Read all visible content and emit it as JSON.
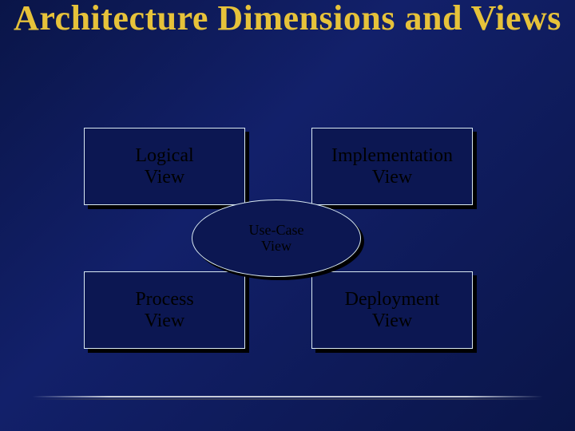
{
  "title_line1": "Architecture Dimensions",
  "title_line2": "and Views",
  "views": {
    "top_left": "Logical View",
    "top_right": "Implementation View",
    "bottom_left": "Process View",
    "bottom_right": "Deployment View",
    "center": "Use-Case View"
  },
  "colors": {
    "background": "#0c1752",
    "title": "#e6c23a",
    "box_border": "#d9e9f2",
    "shadow": "#000000"
  }
}
